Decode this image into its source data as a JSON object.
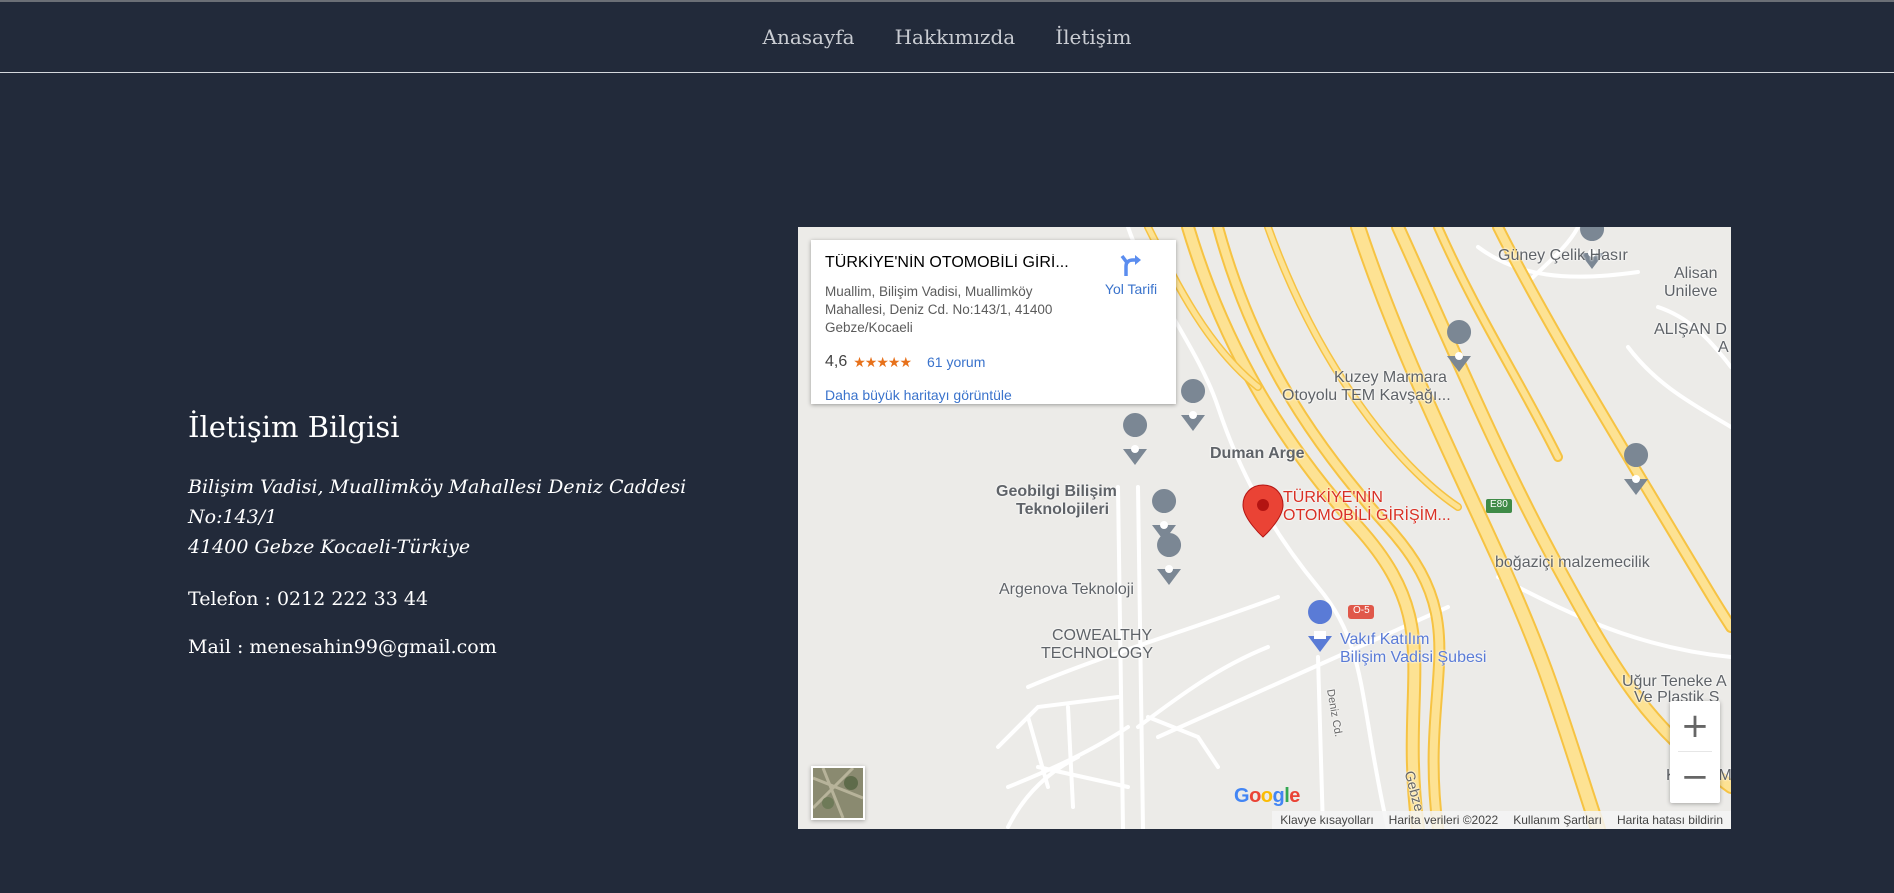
{
  "nav": {
    "items": [
      "Anasayfa",
      "Hakkımızda",
      "İletişim"
    ]
  },
  "contact": {
    "heading": "İletişim Bilgisi",
    "address_line1": "Bilişim Vadisi, Muallimköy Mahallesi Deniz Caddesi No:143/1",
    "address_line2": "41400 Gebze Kocaeli-Türkiye",
    "phone": "Telefon : 0212 222 33 44",
    "mail": "Mail : menesahin99@gmail.com"
  },
  "map": {
    "card": {
      "place_name": "TÜRKİYE'NİN OTOMOBİLİ GİRİ...",
      "address": "Muallim, Bilişim Vadisi, Muallimköy Mahallesi, Deniz Cd. No:143/1, 41400 Gebze/Kocaeli",
      "rating": "4,6",
      "stars": "★★★★★",
      "reviews": "61 yorum",
      "bigger_map": "Daha büyük haritayı görüntüle",
      "directions": "Yol Tarifi"
    },
    "labels": {
      "guney": "Güney Çelik Hasır",
      "alisan1": "Alisan",
      "alisan2": "Unileve",
      "alisan3": "ALIŞAN D",
      "alisan4": "A",
      "kuzey1": "Kuzey Marmara",
      "kuzey2": "Otoyolu TEM Kavşağı...",
      "duman": "Duman Arge",
      "geobilgi1": "Geobilgi Bilişim",
      "geobilgi2": "Teknolojileri",
      "togg1": "TÜRKİYE'NİN",
      "togg2": "OTOMOBİLİ GİRİŞİM...",
      "bogazici": "boğaziçi malzemecilik",
      "argenova": "Argenova Teknoloji",
      "cowealthy1": "COWEALTHY",
      "cowealthy2": "TECHNOLOGY",
      "vakif1": "Vakıf Katılım",
      "vakif2": "Bilişim Vadisi Şubesi",
      "ugur1": "Uğur Teneke A",
      "ugur2": "Ve Plastik S",
      "keskin": "Keskin M",
      "deniz": "Deniz Cd.",
      "gebze": "Gebze",
      "e80": "E80",
      "o5": "O-5"
    },
    "zoom_in": "+",
    "zoom_out": "−",
    "google": "Google",
    "footer": [
      "Klavye kısayolları",
      "Harita verileri ©2022",
      "Kullanım Şartları",
      "Harita hatası bildirin"
    ]
  },
  "colors": {
    "background": "#222a3a",
    "road_highway": "#fde293",
    "road_edge": "#f6c343",
    "pin_red": "#ea4335",
    "pin_grey": "#7b8794",
    "link_blue": "#3a73cc"
  }
}
